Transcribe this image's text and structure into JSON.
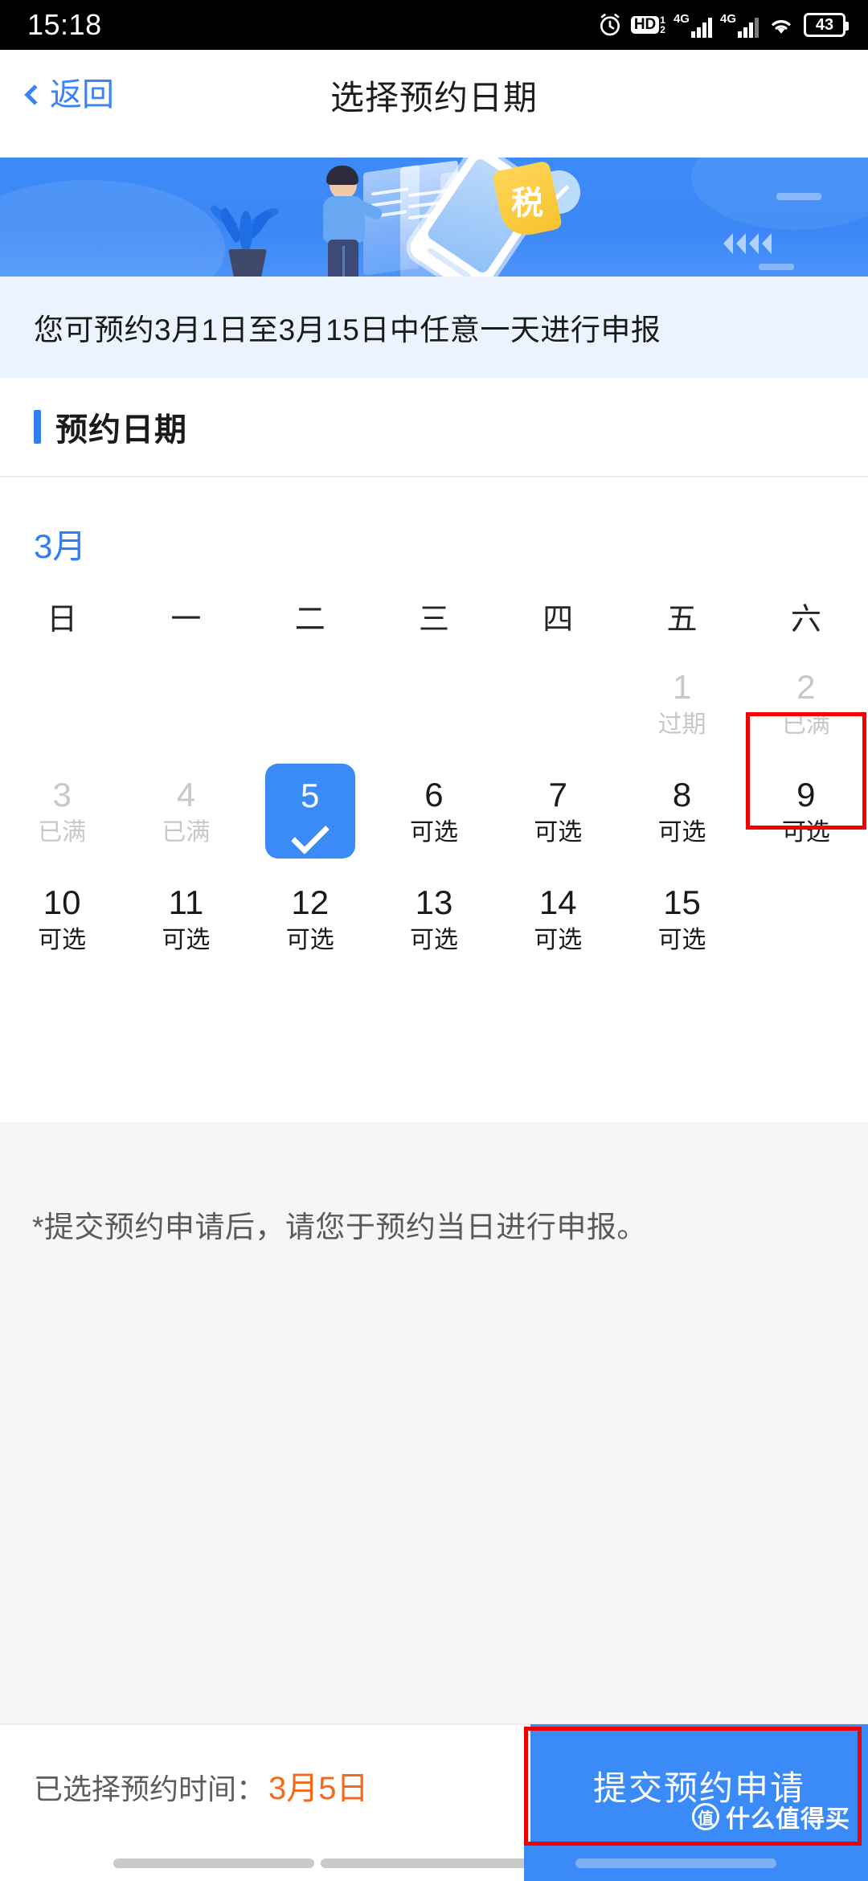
{
  "status_bar": {
    "time": "15:18",
    "alarm_icon": "alarm-clock-icon",
    "hd_label": "HD",
    "hd_sup": "1",
    "hd_sub": "2",
    "sim1_network": "4G",
    "sim2_network": "4G",
    "wifi_icon": "wifi-icon",
    "battery_level": "43"
  },
  "nav": {
    "back_label": "返回",
    "title": "选择预约日期"
  },
  "banner": {
    "tax_badge_text": "税",
    "alt": "税务申报预约插画"
  },
  "notice": {
    "text": "您可预约3月1日至3月15日中任意一天进行申报"
  },
  "section": {
    "title": "预约日期"
  },
  "calendar": {
    "month_label": "3月",
    "weekdays": [
      "日",
      "一",
      "二",
      "三",
      "四",
      "五",
      "六"
    ],
    "leading_blanks": 5,
    "days": [
      {
        "num": "1",
        "status": "过期",
        "state": "disabled"
      },
      {
        "num": "2",
        "status": "已满",
        "state": "disabled"
      },
      {
        "num": "3",
        "status": "已满",
        "state": "disabled"
      },
      {
        "num": "4",
        "status": "已满",
        "state": "disabled"
      },
      {
        "num": "5",
        "status": "",
        "state": "selected"
      },
      {
        "num": "6",
        "status": "可选",
        "state": "available"
      },
      {
        "num": "7",
        "status": "可选",
        "state": "available"
      },
      {
        "num": "8",
        "status": "可选",
        "state": "available"
      },
      {
        "num": "9",
        "status": "可选",
        "state": "available"
      },
      {
        "num": "10",
        "status": "可选",
        "state": "available"
      },
      {
        "num": "11",
        "status": "可选",
        "state": "available"
      },
      {
        "num": "12",
        "status": "可选",
        "state": "available"
      },
      {
        "num": "13",
        "status": "可选",
        "state": "available"
      },
      {
        "num": "14",
        "status": "可选",
        "state": "available"
      },
      {
        "num": "15",
        "status": "可选",
        "state": "available"
      }
    ]
  },
  "footnote": {
    "text": "*提交预约申请后，请您于预约当日进行申报。"
  },
  "bottom": {
    "selected_label": "已选择预约时间：",
    "selected_value": "3月5日",
    "submit_label": "提交预约申请"
  },
  "watermark": {
    "mark": "值",
    "text": "什么值得买"
  },
  "colors": {
    "accent_blue": "#3a8bf7",
    "link_blue": "#3a84f5",
    "notice_bg": "#eaf3fe",
    "orange": "#f26a1b",
    "annotation_red": "#f40000",
    "disabled_gray": "#c8c8c8"
  }
}
